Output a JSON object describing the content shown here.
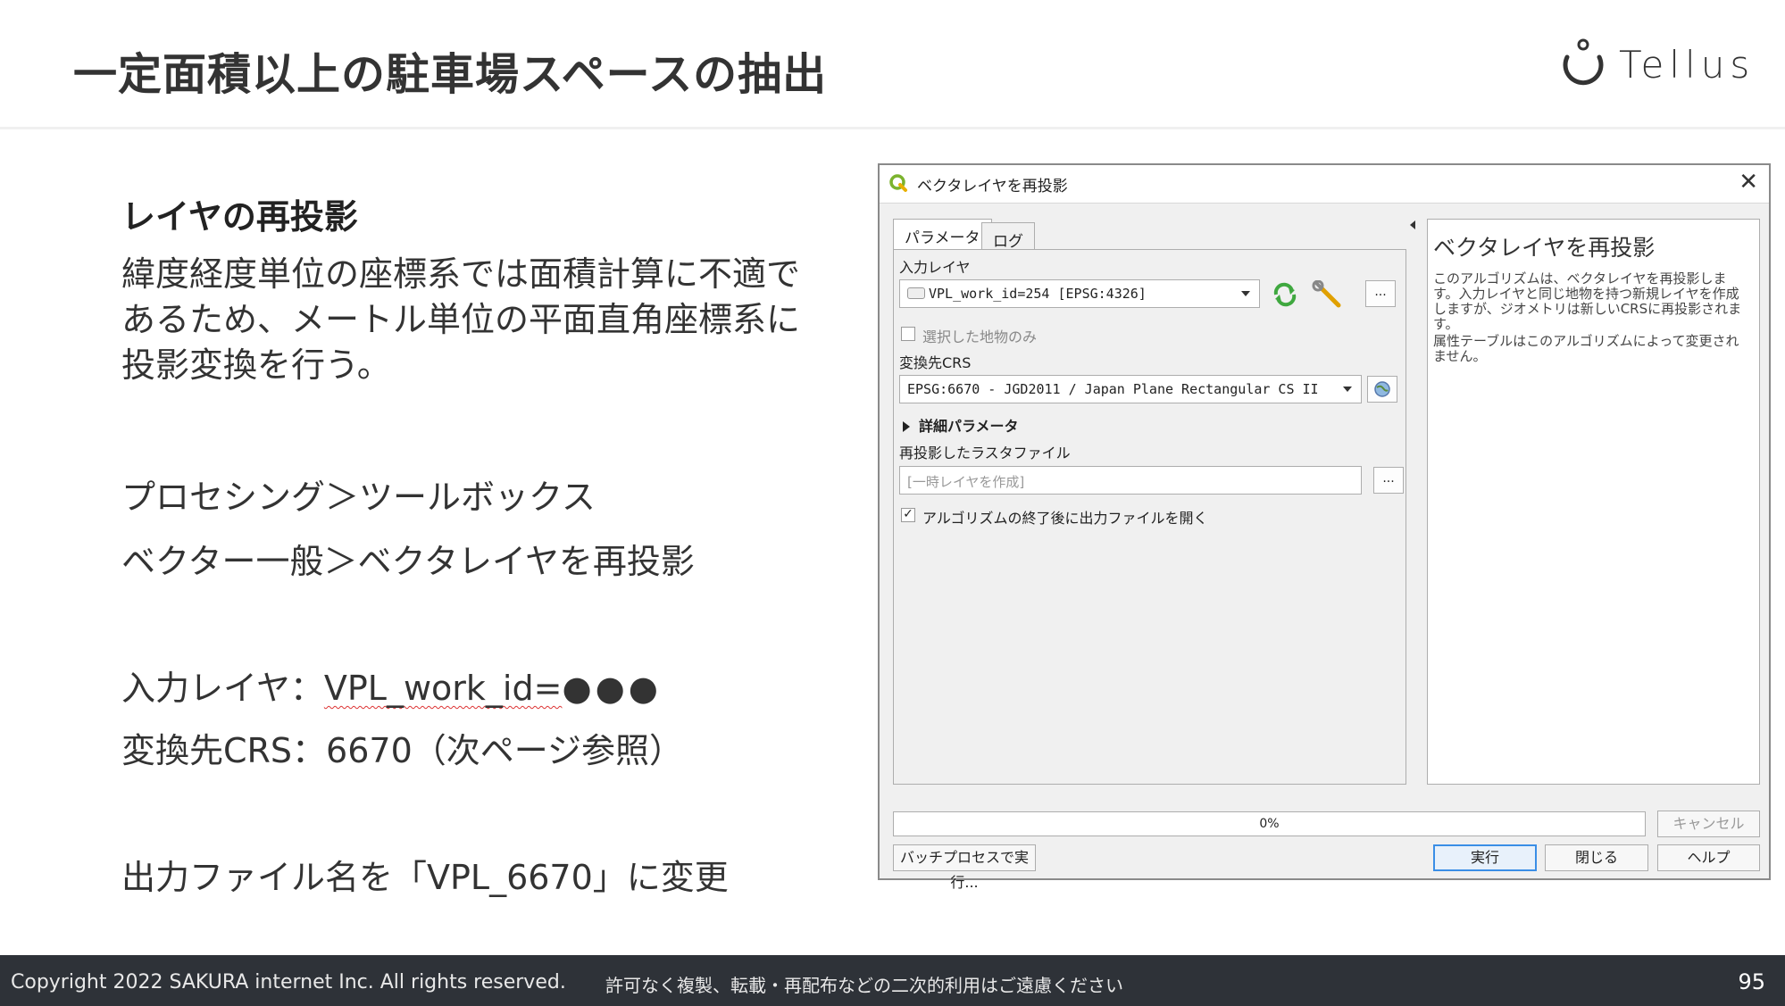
{
  "slide": {
    "title": "一定面積以上の駐車場スペースの抽出",
    "logo_text": "Tellus",
    "section_title": "レイヤの再投影",
    "description_lines": [
      "緯度経度単位の座標系では面積計算に不適で",
      "あるため、メートル単位の平面直角座標系に",
      "投影変換を行う。"
    ],
    "menu_path_1": "プロセシング＞ツールボックス",
    "menu_path_2": "ベクター一般＞ベクタレイヤを再投影",
    "input_layer_label": "入力レイヤ：",
    "input_layer_value": "VPL_work_id=",
    "input_layer_dots": "●●●",
    "target_crs_line": "変換先CRS：6670（次ページ参照）",
    "output_line": "出力ファイル名を「VPL_6670」に変更"
  },
  "dialog": {
    "title": "ベクタレイヤを再投影",
    "tabs": [
      "パラメータ",
      "ログ"
    ],
    "input_layer_label": "入力レイヤ",
    "input_layer_value": "VPL_work_id=254 [EPSG:4326]",
    "selected_only_label": "選択した地物のみ",
    "target_crs_label": "変換先CRS",
    "target_crs_value": "EPSG:6670 - JGD2011 / Japan Plane Rectangular CS II",
    "advanced_label": "詳細パラメータ",
    "output_label": "再投影したラスタファイル",
    "output_placeholder": "[一時レイヤを作成]",
    "open_after_label": "アルゴリズムの終了後に出力ファイルを開く",
    "help_title": "ベクタレイヤを再投影",
    "help_p1": "このアルゴリズムは、ベクタレイヤを再投影します。入力レイヤと同じ地物を持つ新規レイヤを作成しますが、ジオメトリは新しいCRSに再投影されます。",
    "help_p2": "属性テーブルはこのアルゴリズムによって変更されません。",
    "progress_text": "0%",
    "progress": 0,
    "cancel_label": "キャンセル",
    "batch_label": "バッチプロセスで実行...",
    "run_label": "実行",
    "close_label": "閉じる",
    "help_label": "ヘルプ",
    "more_label": "...",
    "browse_label": "..."
  },
  "footer": {
    "copyright": "Copyright 2022 SAKURA internet Inc. All rights reserved.",
    "notice": "許可なく複製、転載・再配布などの二次的利用はご遠慮ください",
    "page_number": "95"
  },
  "colors": {
    "footer_bg": "#2e3238",
    "qgis_green": "#7bb32e",
    "primary_border": "#3a8ee6"
  }
}
